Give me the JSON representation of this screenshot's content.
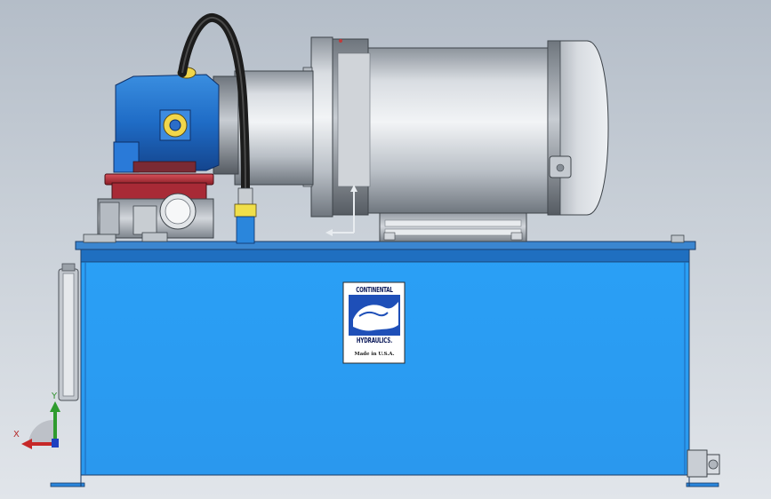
{
  "viewport": {
    "background_top": "#b4bdc8",
    "background_bottom": "#e1e5ea"
  },
  "model": {
    "tank_color": "#2b9cf0",
    "pump_color": "#1e6ec8",
    "motor_color": "#c0c6ce",
    "hose_color": "#1c1c1c",
    "fitting_color": "#e8d84a"
  },
  "nameplate": {
    "brand_line1": "CONTINENTAL",
    "brand_line2": "HYDRAULICS.",
    "made_in": "Made in U.S.A.",
    "logo_color": "#1e4fb8"
  },
  "triad": {
    "x_label": "X",
    "y_label": "Y",
    "x_color": "#c62828",
    "y_color": "#2e9b2e",
    "z_color": "#1e40c0",
    "x_icon": "x-axis-arrow-icon",
    "y_icon": "y-axis-arrow-icon",
    "z_icon": "z-axis-arrow-icon"
  }
}
